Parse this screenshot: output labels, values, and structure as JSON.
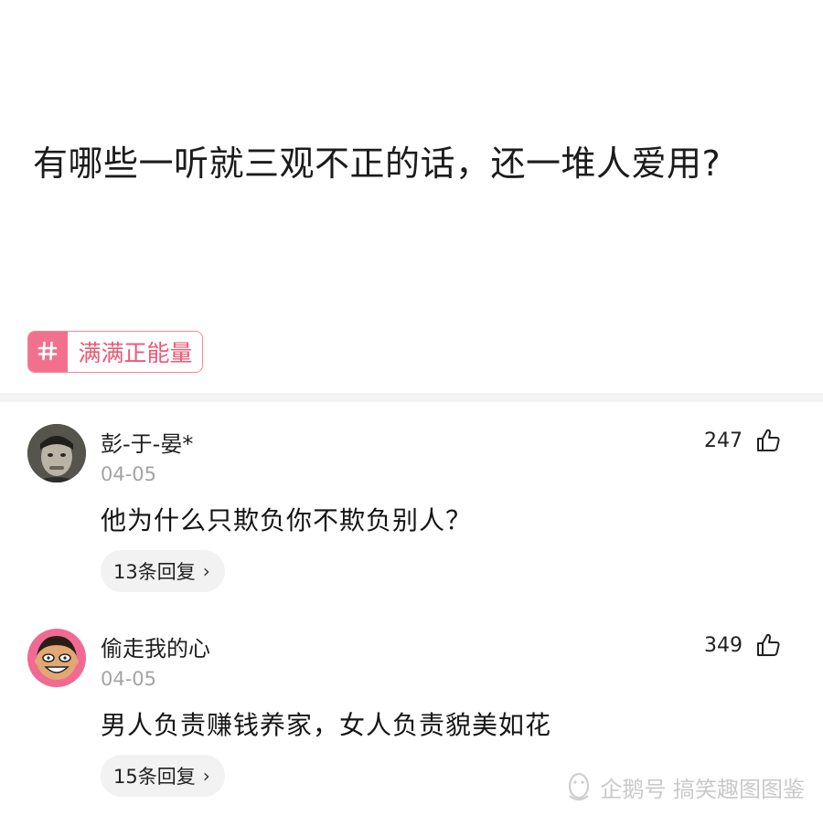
{
  "question": {
    "title": "有哪些一听就三观不正的话，还一堆人爱用?"
  },
  "topic_tag": {
    "icon": "hash-icon",
    "label": "满满正能量",
    "color": "#ee5876"
  },
  "comments": [
    {
      "username": "彭-于-晏*",
      "date": "04-05",
      "likes": "247",
      "text": "他为什么只欺负你不欺负别人？",
      "replies": "13条回复",
      "chevron": "›"
    },
    {
      "username": "偷走我的心",
      "date": "04-05",
      "likes": "349",
      "text": "男人负责赚钱养家，女人负责貌美如花",
      "replies": "15条回复",
      "chevron": "›"
    }
  ],
  "watermark": {
    "text": "企鹅号 搞笑趣图图鉴"
  }
}
